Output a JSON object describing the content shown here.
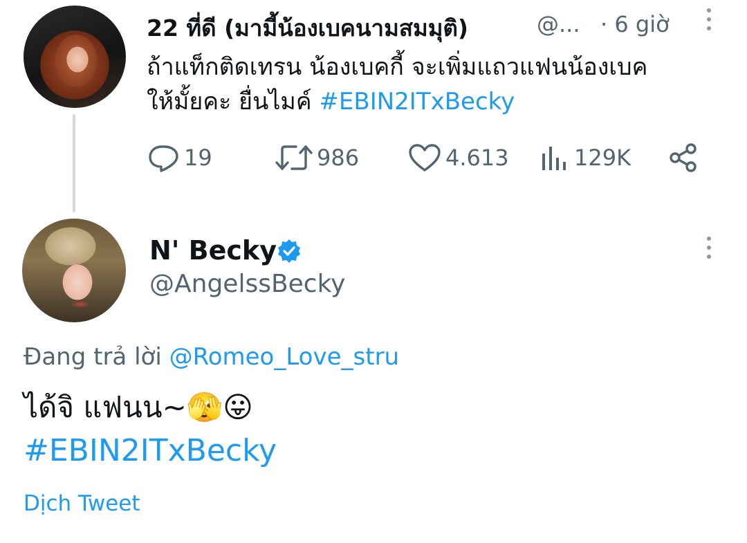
{
  "tweet1": {
    "author_name": "22 ที่ดี (มามี้น้องเบคนามสมมุติ)",
    "author_handle": "@...",
    "time": "· 6 giờ",
    "text_line1": "ถ้าแท็กติดเทรน น้องเบคกี้ จะเพิ่มแถวแฟนน้องเบค",
    "text_line2": "ให้มั้ยคะ ยื่นไมค์",
    "hashtag": "#EBIN2ITxBecky",
    "actions": {
      "replies": "19",
      "retweets": "986",
      "likes": "4.613",
      "views": "129K"
    }
  },
  "tweet2": {
    "author_name": "N' Becky",
    "author_handle": "@AngelssBecky",
    "replying_label": "Đang trả lời",
    "replying_to": "@Romeo_Love_stru",
    "text": "ได้จิ แฟนน~🫣😛",
    "hashtag": "#EBIN2ITxBecky",
    "translate_label": "Dịch Tweet"
  },
  "colors": {
    "accent": "#1d9bf0",
    "secondary_text": "#536471",
    "primary_text": "#0f1419"
  },
  "icons": [
    "reply-icon",
    "retweet-icon",
    "like-icon",
    "views-icon",
    "share-icon",
    "more-icon",
    "verified-icon"
  ]
}
